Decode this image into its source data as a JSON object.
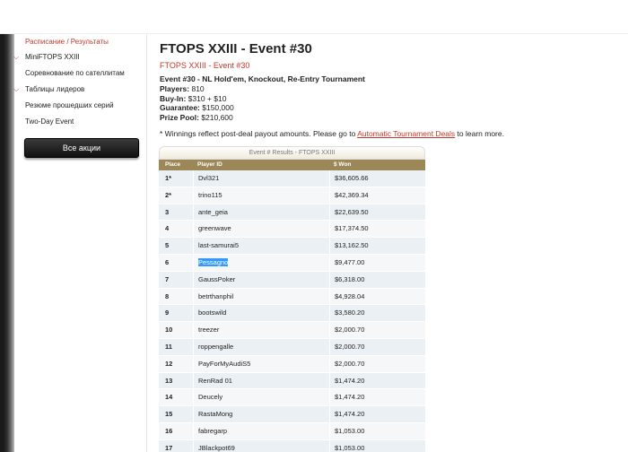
{
  "nav": {
    "items": [
      {
        "label": "Расписание / Результаты",
        "active": true,
        "chevron": false
      },
      {
        "label": "MiniFTOPS XXIII",
        "active": false,
        "chevron": true
      },
      {
        "label": "Соревнование по сателлитам",
        "active": false,
        "chevron": false
      },
      {
        "label": "Таблицы лидеров",
        "active": false,
        "chevron": true
      },
      {
        "label": "Резюме прошедших серий",
        "active": false,
        "chevron": false
      },
      {
        "label": "Two-Day Event",
        "active": false,
        "chevron": false
      }
    ],
    "promo_button": "Все акции"
  },
  "page": {
    "title": "FTOPS XXIII - Event #30",
    "subtitle": "FTOPS XXIII - Event #30",
    "event_line": "Event #30 - NL Hold'em, Knockout, Re-Entry Tournament",
    "players_label": "Players:",
    "players_value": "810",
    "buyin_label": "Buy-In:",
    "buyin_value": "$310 + $10",
    "guarantee_label": "Guarantee:",
    "guarantee_value": "$150,000",
    "prize_label": "Prize Pool:",
    "prize_value": "$210,600",
    "note_before": "* Winnings reflect post-deal payout amounts. Please go to ",
    "note_link": "Automatic Tournament Deals",
    "note_after": " to learn more."
  },
  "results": {
    "caption": "Event # Results - FTOPS XXIII",
    "headers": {
      "place": "Place",
      "player": "Player ID",
      "won": "$ Won"
    },
    "rows": [
      {
        "place": "1*",
        "player": "Dvl321",
        "won": "$36,605.66"
      },
      {
        "place": "2*",
        "player": "trino115",
        "won": "$42,369.34"
      },
      {
        "place": "3",
        "player": "ante_geia",
        "won": "$22,639.50"
      },
      {
        "place": "4",
        "player": "greenwave",
        "won": "$17,374.50"
      },
      {
        "place": "5",
        "player": "last-samurai5",
        "won": "$13,162.50"
      },
      {
        "place": "6",
        "player": "Pessagno",
        "won": "$9,477.00",
        "selected": true
      },
      {
        "place": "7",
        "player": "GaussPoker",
        "won": "$6,318.00"
      },
      {
        "place": "8",
        "player": "betrthanphil",
        "won": "$4,928.04"
      },
      {
        "place": "9",
        "player": "bootswild",
        "won": "$3,580.20"
      },
      {
        "place": "10",
        "player": "treezer",
        "won": "$2,000.70"
      },
      {
        "place": "11",
        "player": "roppengalle",
        "won": "$2,000.70"
      },
      {
        "place": "12",
        "player": "PayForMyAudiS5",
        "won": "$2,000.70"
      },
      {
        "place": "13",
        "player": "RenRad 01",
        "won": "$1,474.20"
      },
      {
        "place": "14",
        "player": "Deucely",
        "won": "$1,474.20"
      },
      {
        "place": "15",
        "player": "RastaMong",
        "won": "$1,474.20"
      },
      {
        "place": "16",
        "player": "fabregarp",
        "won": "$1,053.00"
      },
      {
        "place": "17",
        "player": "JBlackpot69",
        "won": "$1,053.00"
      }
    ]
  }
}
